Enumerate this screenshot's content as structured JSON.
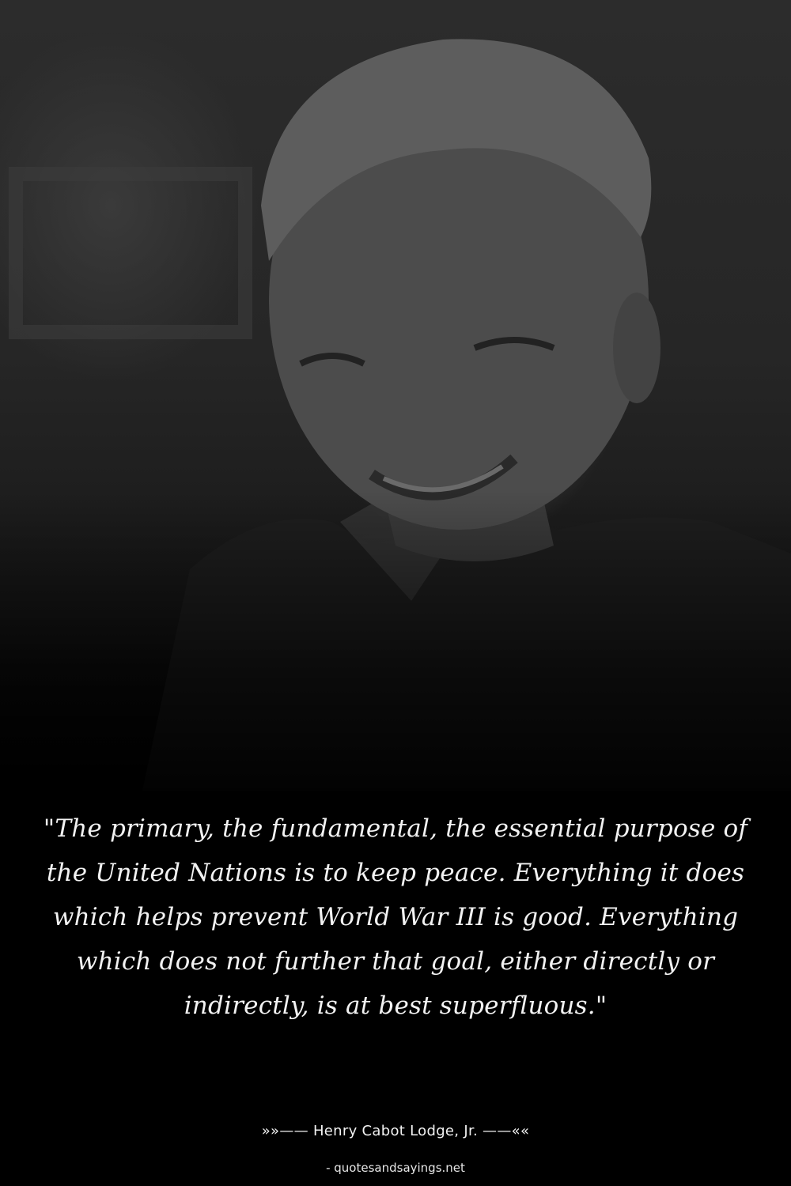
{
  "quote": {
    "text": "\"The primary, the fundamental, the essential purpose of the United Nations is to keep peace. Everything it does which helps prevent World War III is good. Everything which does not further that goal, either directly or indirectly, is at best superfluous.\""
  },
  "author": {
    "line": "»»—— Henry Cabot Lodge, Jr. ——««"
  },
  "source": {
    "text": "- quotesandsayings.net"
  },
  "colors": {
    "background": "#000000",
    "text": "#f2f2f2"
  }
}
